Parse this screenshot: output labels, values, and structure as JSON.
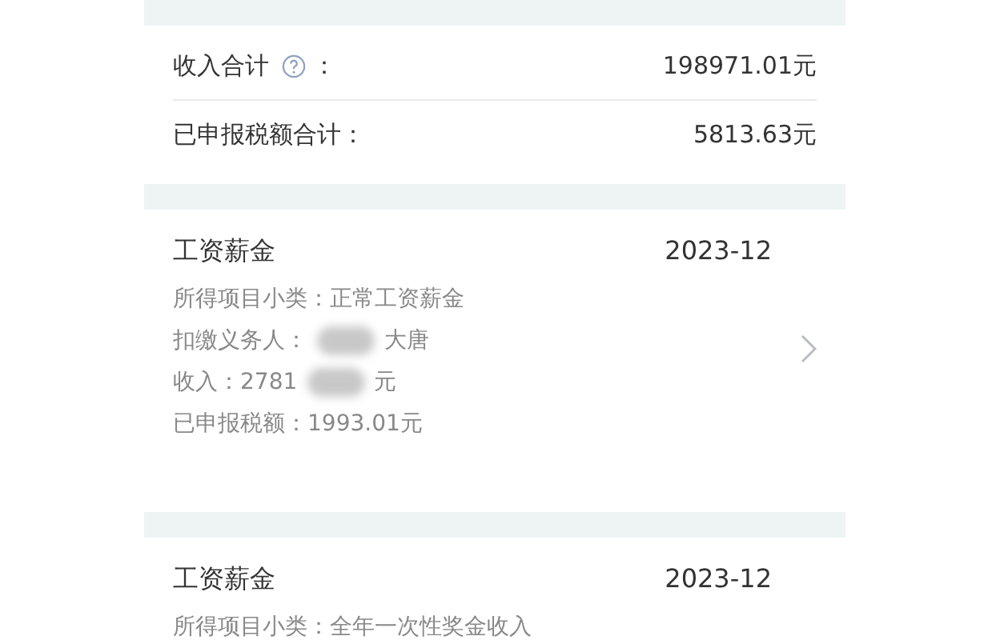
{
  "summary": [
    {
      "label": "收入合计",
      "help": true,
      "colon": "：",
      "value": "198971.01元"
    },
    {
      "label": "已申报税额合计：",
      "help": false,
      "value": "5813.63元"
    }
  ],
  "records": [
    {
      "title": "工资薪金",
      "period": "2023-12",
      "has_arrow": true,
      "lines": [
        {
          "text": "所得项目小类：正常工资薪金",
          "redacted": false
        },
        {
          "text": "扣缴义务人：",
          "redacted": true,
          "tail": "大唐"
        },
        {
          "text": "收入：2781",
          "redacted": true,
          "tail": "元"
        },
        {
          "text": "已申报税额：1993.01元",
          "redacted": false
        }
      ]
    },
    {
      "title": "工资薪金",
      "period": "2023-12",
      "has_arrow": false,
      "lines": [
        {
          "text": "所得项目小类：全年一次性奖金收入",
          "redacted": false
        }
      ]
    }
  ]
}
